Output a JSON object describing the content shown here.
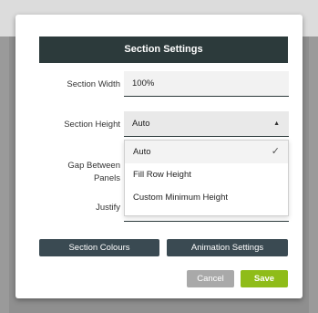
{
  "modal": {
    "title": "Section Settings",
    "section_width": {
      "label": "Section Width",
      "value": "100%"
    },
    "section_height": {
      "label": "Section Height",
      "value": "Auto",
      "options": [
        "Auto",
        "Fill Row Height",
        "Custom Minimum Height"
      ]
    },
    "gap_between_panels": {
      "label_line1": "Gap Between",
      "label_line2": "Panels"
    },
    "justify": {
      "label": "Justify"
    },
    "buttons": {
      "section_colours": "Section Colours",
      "animation_settings": "Animation Settings",
      "cancel": "Cancel",
      "save": "Save"
    }
  },
  "colors": {
    "header": "#2c3a3b",
    "secondary_button": "#3a4a52",
    "cancel": "#a9a9a9",
    "save": "#8fbc19"
  }
}
